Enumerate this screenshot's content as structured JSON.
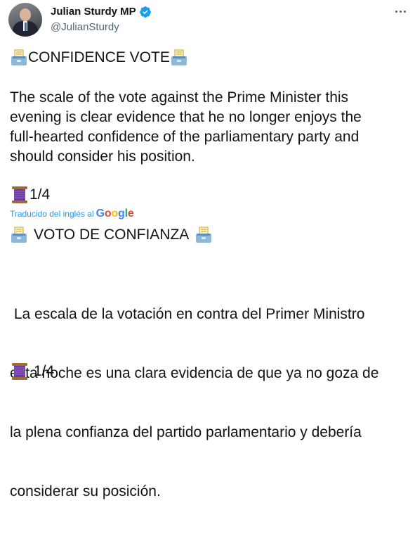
{
  "author": {
    "display_name": "Julian Sturdy MP",
    "handle": "@JulianSturdy"
  },
  "original": {
    "headline": "CONFIDENCE VOTE",
    "paragraph_lines": [
      "The scale of the vote against the Prime Minister this",
      "evening is clear evidence that he no longer enjoys the",
      "full-hearted confidence of the parliamentary party and",
      "should consider his position."
    ],
    "counter": "1/4"
  },
  "translation": {
    "label": "Traducido del inglés al",
    "provider": "Google",
    "headline": "VOTO DE CONFIANZA",
    "paragraph_lines": [
      " La escala de la votación en contra del Primer Ministro",
      "esta noche es una clara evidencia de que ya no goza de",
      "la plena confianza del partido parlamentario y debería",
      "considerar su posición."
    ],
    "counter": "1/4"
  },
  "icons": {
    "verified": "verified-badge-icon",
    "more": "more-options-icon",
    "ballot": "ballot-box-emoji",
    "thread": "thread-spool-emoji"
  },
  "colors": {
    "text": "#0f1419",
    "secondary": "#536471",
    "link": "#1d9bf0",
    "verified": "#1d9bf0"
  }
}
